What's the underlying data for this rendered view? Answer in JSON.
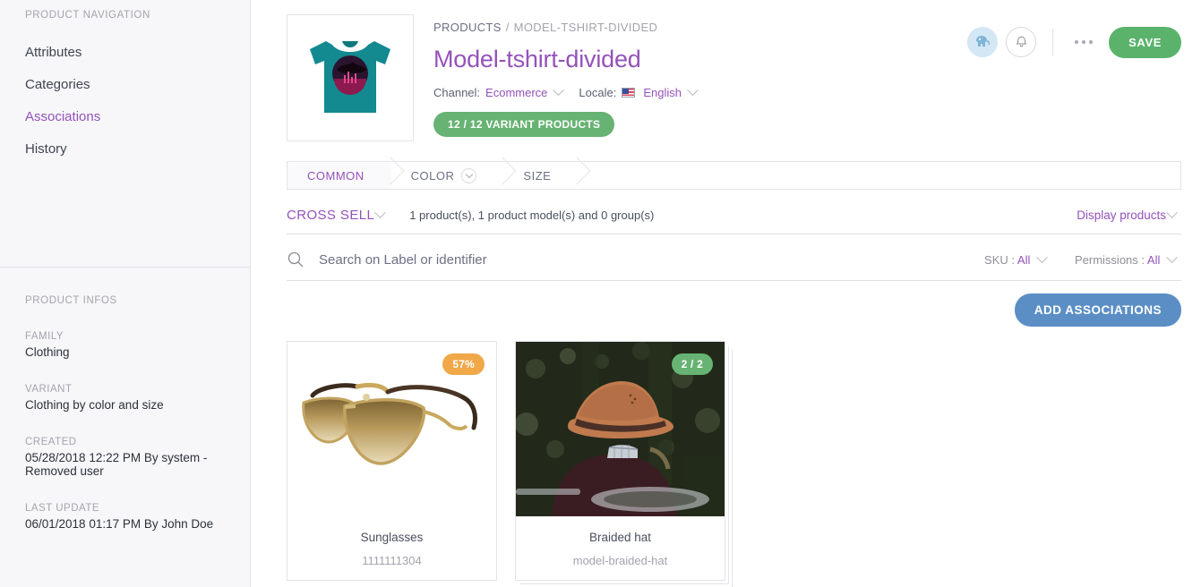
{
  "sidebar": {
    "nav_title": "PRODUCT NAVIGATION",
    "items": [
      {
        "label": "Attributes",
        "active": false
      },
      {
        "label": "Categories",
        "active": false
      },
      {
        "label": "Associations",
        "active": true
      },
      {
        "label": "History",
        "active": false
      }
    ],
    "infos_title": "PRODUCT INFOS",
    "infos": [
      {
        "label": "FAMILY",
        "value": "Clothing"
      },
      {
        "label": "VARIANT",
        "value": "Clothing by color and size"
      },
      {
        "label": "CREATED",
        "value": "05/28/2018 12:22 PM By system - Removed user"
      },
      {
        "label": "LAST UPDATE",
        "value": "06/01/2018 01:17 PM By John Doe"
      }
    ]
  },
  "header": {
    "breadcrumb_root": "PRODUCTS",
    "breadcrumb_sep": "/",
    "breadcrumb_current": "MODEL-TSHIRT-DIVIDED",
    "title": "Model-tshirt-divided",
    "channel_label": "Channel:",
    "channel_value": "Ecommerce",
    "locale_label": "Locale:",
    "locale_value": "English",
    "variant_badge": "12 / 12 VARIANT PRODUCTS",
    "save_label": "SAVE",
    "icons": {
      "avatar": "avatar-icon",
      "bell": "bell-icon",
      "more": "more-options-icon"
    }
  },
  "tabs": [
    {
      "label": "COMMON",
      "active": true,
      "has_chevron": false
    },
    {
      "label": "COLOR",
      "active": false,
      "has_chevron": true
    },
    {
      "label": "SIZE",
      "active": false,
      "has_chevron": false
    }
  ],
  "cross_sell": {
    "title": "CROSS SELL",
    "count": "1 product(s), 1 product model(s) and 0 group(s)",
    "display_products": "Display products"
  },
  "search": {
    "placeholder": "Search on Label or identifier",
    "value": "",
    "filters": [
      {
        "label": "SKU :",
        "value": "All"
      },
      {
        "label": "Permissions :",
        "value": "All"
      }
    ]
  },
  "actions": {
    "add_associations": "ADD ASSOCIATIONS"
  },
  "cards": [
    {
      "label": "Sunglasses",
      "identifier": "1111111304",
      "badge": "57%",
      "badge_color": "#f0a848",
      "badge_type": "orange",
      "is_model": false,
      "image": "sunglasses-photo"
    },
    {
      "label": "Braided hat",
      "identifier": "model-braided-hat",
      "badge": "2 / 2",
      "badge_color": "#67b373",
      "badge_type": "green",
      "is_model": true,
      "image": "braided-hat-photo"
    }
  ],
  "colors": {
    "accent_purple": "#9452ba",
    "green": "#67b373",
    "blue": "#5b8ec4",
    "orange": "#f0a848",
    "sidebar_bg": "#f7f7fa"
  }
}
